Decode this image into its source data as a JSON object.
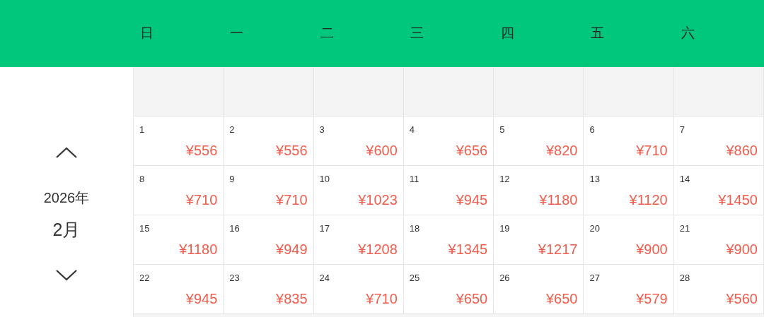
{
  "weekdays": [
    "日",
    "一",
    "二",
    "三",
    "四",
    "五",
    "六"
  ],
  "nav": {
    "year": "2026年",
    "month": "2月"
  },
  "weeks": [
    [
      {
        "kind": "empty"
      },
      {
        "kind": "empty"
      },
      {
        "kind": "empty"
      },
      {
        "kind": "empty"
      },
      {
        "kind": "empty"
      },
      {
        "kind": "empty"
      },
      {
        "kind": "empty"
      }
    ],
    [
      {
        "kind": "day",
        "day": "1",
        "price": "¥556"
      },
      {
        "kind": "day",
        "day": "2",
        "price": "¥556"
      },
      {
        "kind": "day",
        "day": "3",
        "price": "¥600"
      },
      {
        "kind": "day",
        "day": "4",
        "price": "¥656"
      },
      {
        "kind": "day",
        "day": "5",
        "price": "¥820"
      },
      {
        "kind": "day",
        "day": "6",
        "price": "¥710"
      },
      {
        "kind": "day",
        "day": "7",
        "price": "¥860"
      }
    ],
    [
      {
        "kind": "day",
        "day": "8",
        "price": "¥710"
      },
      {
        "kind": "day",
        "day": "9",
        "price": "¥710"
      },
      {
        "kind": "day",
        "day": "10",
        "price": "¥1023"
      },
      {
        "kind": "day",
        "day": "11",
        "price": "¥945"
      },
      {
        "kind": "day",
        "day": "12",
        "price": "¥1180"
      },
      {
        "kind": "day",
        "day": "13",
        "price": "¥1120"
      },
      {
        "kind": "day",
        "day": "14",
        "price": "¥1450"
      }
    ],
    [
      {
        "kind": "day",
        "day": "15",
        "price": "¥1180"
      },
      {
        "kind": "day",
        "day": "16",
        "price": "¥949"
      },
      {
        "kind": "day",
        "day": "17",
        "price": "¥1208"
      },
      {
        "kind": "day",
        "day": "18",
        "price": "¥1345"
      },
      {
        "kind": "day",
        "day": "19",
        "price": "¥1217"
      },
      {
        "kind": "day",
        "day": "20",
        "price": "¥900"
      },
      {
        "kind": "day",
        "day": "21",
        "price": "¥900"
      }
    ],
    [
      {
        "kind": "day",
        "day": "22",
        "price": "¥945"
      },
      {
        "kind": "day",
        "day": "23",
        "price": "¥835"
      },
      {
        "kind": "day",
        "day": "24",
        "price": "¥710"
      },
      {
        "kind": "day",
        "day": "25",
        "price": "¥650"
      },
      {
        "kind": "day",
        "day": "26",
        "price": "¥650"
      },
      {
        "kind": "day",
        "day": "27",
        "price": "¥579"
      },
      {
        "kind": "day",
        "day": "28",
        "price": "¥560"
      }
    ]
  ]
}
